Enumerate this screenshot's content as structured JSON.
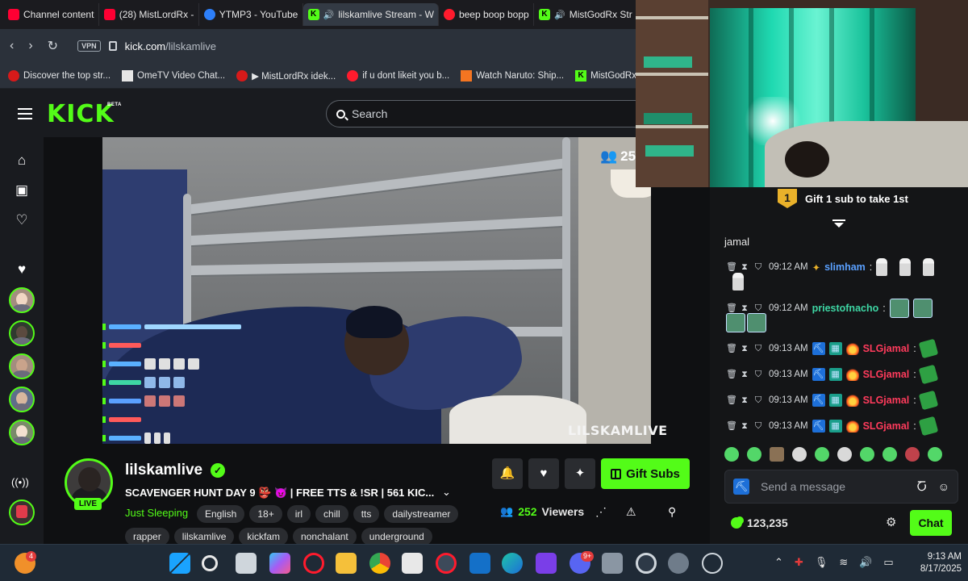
{
  "browser": {
    "tabs": [
      {
        "label": "Channel content",
        "icon": "youtube-icon"
      },
      {
        "label": "(28) MistLordRx -",
        "icon": "youtube-icon"
      },
      {
        "label": "YTMP3 - YouTube",
        "icon": "ytmp3-icon"
      },
      {
        "label": "lilskamlive Stream - W",
        "icon": "kick-icon",
        "active": true
      },
      {
        "label": "beep boop bopp",
        "icon": "opera-icon"
      },
      {
        "label": "MistGodRx Str",
        "icon": "kick-icon"
      }
    ],
    "address": {
      "vpn": "VPN",
      "host": "kick.com",
      "path": "/lilskamlive"
    },
    "bookmarks": [
      {
        "label": "Discover the top str...",
        "icon": "soundcloud-icon"
      },
      {
        "label": "OmeTV Video Chat...",
        "icon": "ometv-icon"
      },
      {
        "label": "▶ MistLordRx idek...",
        "icon": "soundcloud-icon"
      },
      {
        "label": "if u dont likeit you b...",
        "icon": "opera-icon"
      },
      {
        "label": "Watch Naruto: Ship...",
        "icon": "crunchyroll-icon"
      },
      {
        "label": "MistGodRx",
        "icon": "kick-icon"
      }
    ]
  },
  "kick": {
    "logo": "KICK",
    "beta": "BETA",
    "search_placeholder": "Search"
  },
  "video": {
    "watermark": "LILSKAMLIVE",
    "viewer_badge": "25"
  },
  "stream": {
    "channel": "lilskamlive",
    "live": "LIVE",
    "title": "SCAVENGER HUNT DAY 9 👺 😈 | FREE TTS & !SR | 561 KIC...",
    "category": "Just Sleeping",
    "tags": [
      "English",
      "18+",
      "irl",
      "chill",
      "tts",
      "dailystreamer"
    ],
    "tags2": [
      "rapper",
      "lilskamlive",
      "kickfam",
      "nonchalant",
      "underground"
    ],
    "viewers_count": "252",
    "viewers_label": "Viewers",
    "gift_subs_label": "Gift Subs"
  },
  "chat": {
    "gift_banner": "Gift 1 sub to take 1st",
    "rank": "1",
    "pinned_user": "jamal",
    "messages": [
      {
        "time": "09:12 AM",
        "user": "slimham",
        "color": "#5aa0ff",
        "content": "emotes"
      },
      {
        "time": "09:12 AM",
        "user": "priestofnacho",
        "color": "#3ed6a4",
        "content": "emotes"
      },
      {
        "time": "09:13 AM",
        "user": "SLGjamal",
        "color": "#ff3b5c",
        "content": "cash"
      },
      {
        "time": "09:13 AM",
        "user": "SLGjamal",
        "color": "#ff3b5c",
        "content": "cash"
      },
      {
        "time": "09:13 AM",
        "user": "SLGjamal",
        "color": "#ff3b5c",
        "content": "cash"
      },
      {
        "time": "09:13 AM",
        "user": "SLGjamal",
        "color": "#ff3b5c",
        "content": "cash"
      }
    ],
    "input_placeholder": "Send a message",
    "points": "123,235",
    "send_label": "Chat"
  },
  "taskbar": {
    "time": "9:13 AM",
    "date": "8/17/2025",
    "notification_badge": "4",
    "discord_badge": "9+"
  },
  "colors": {
    "accent": "#53fc18",
    "background": "#0b0e0f"
  }
}
